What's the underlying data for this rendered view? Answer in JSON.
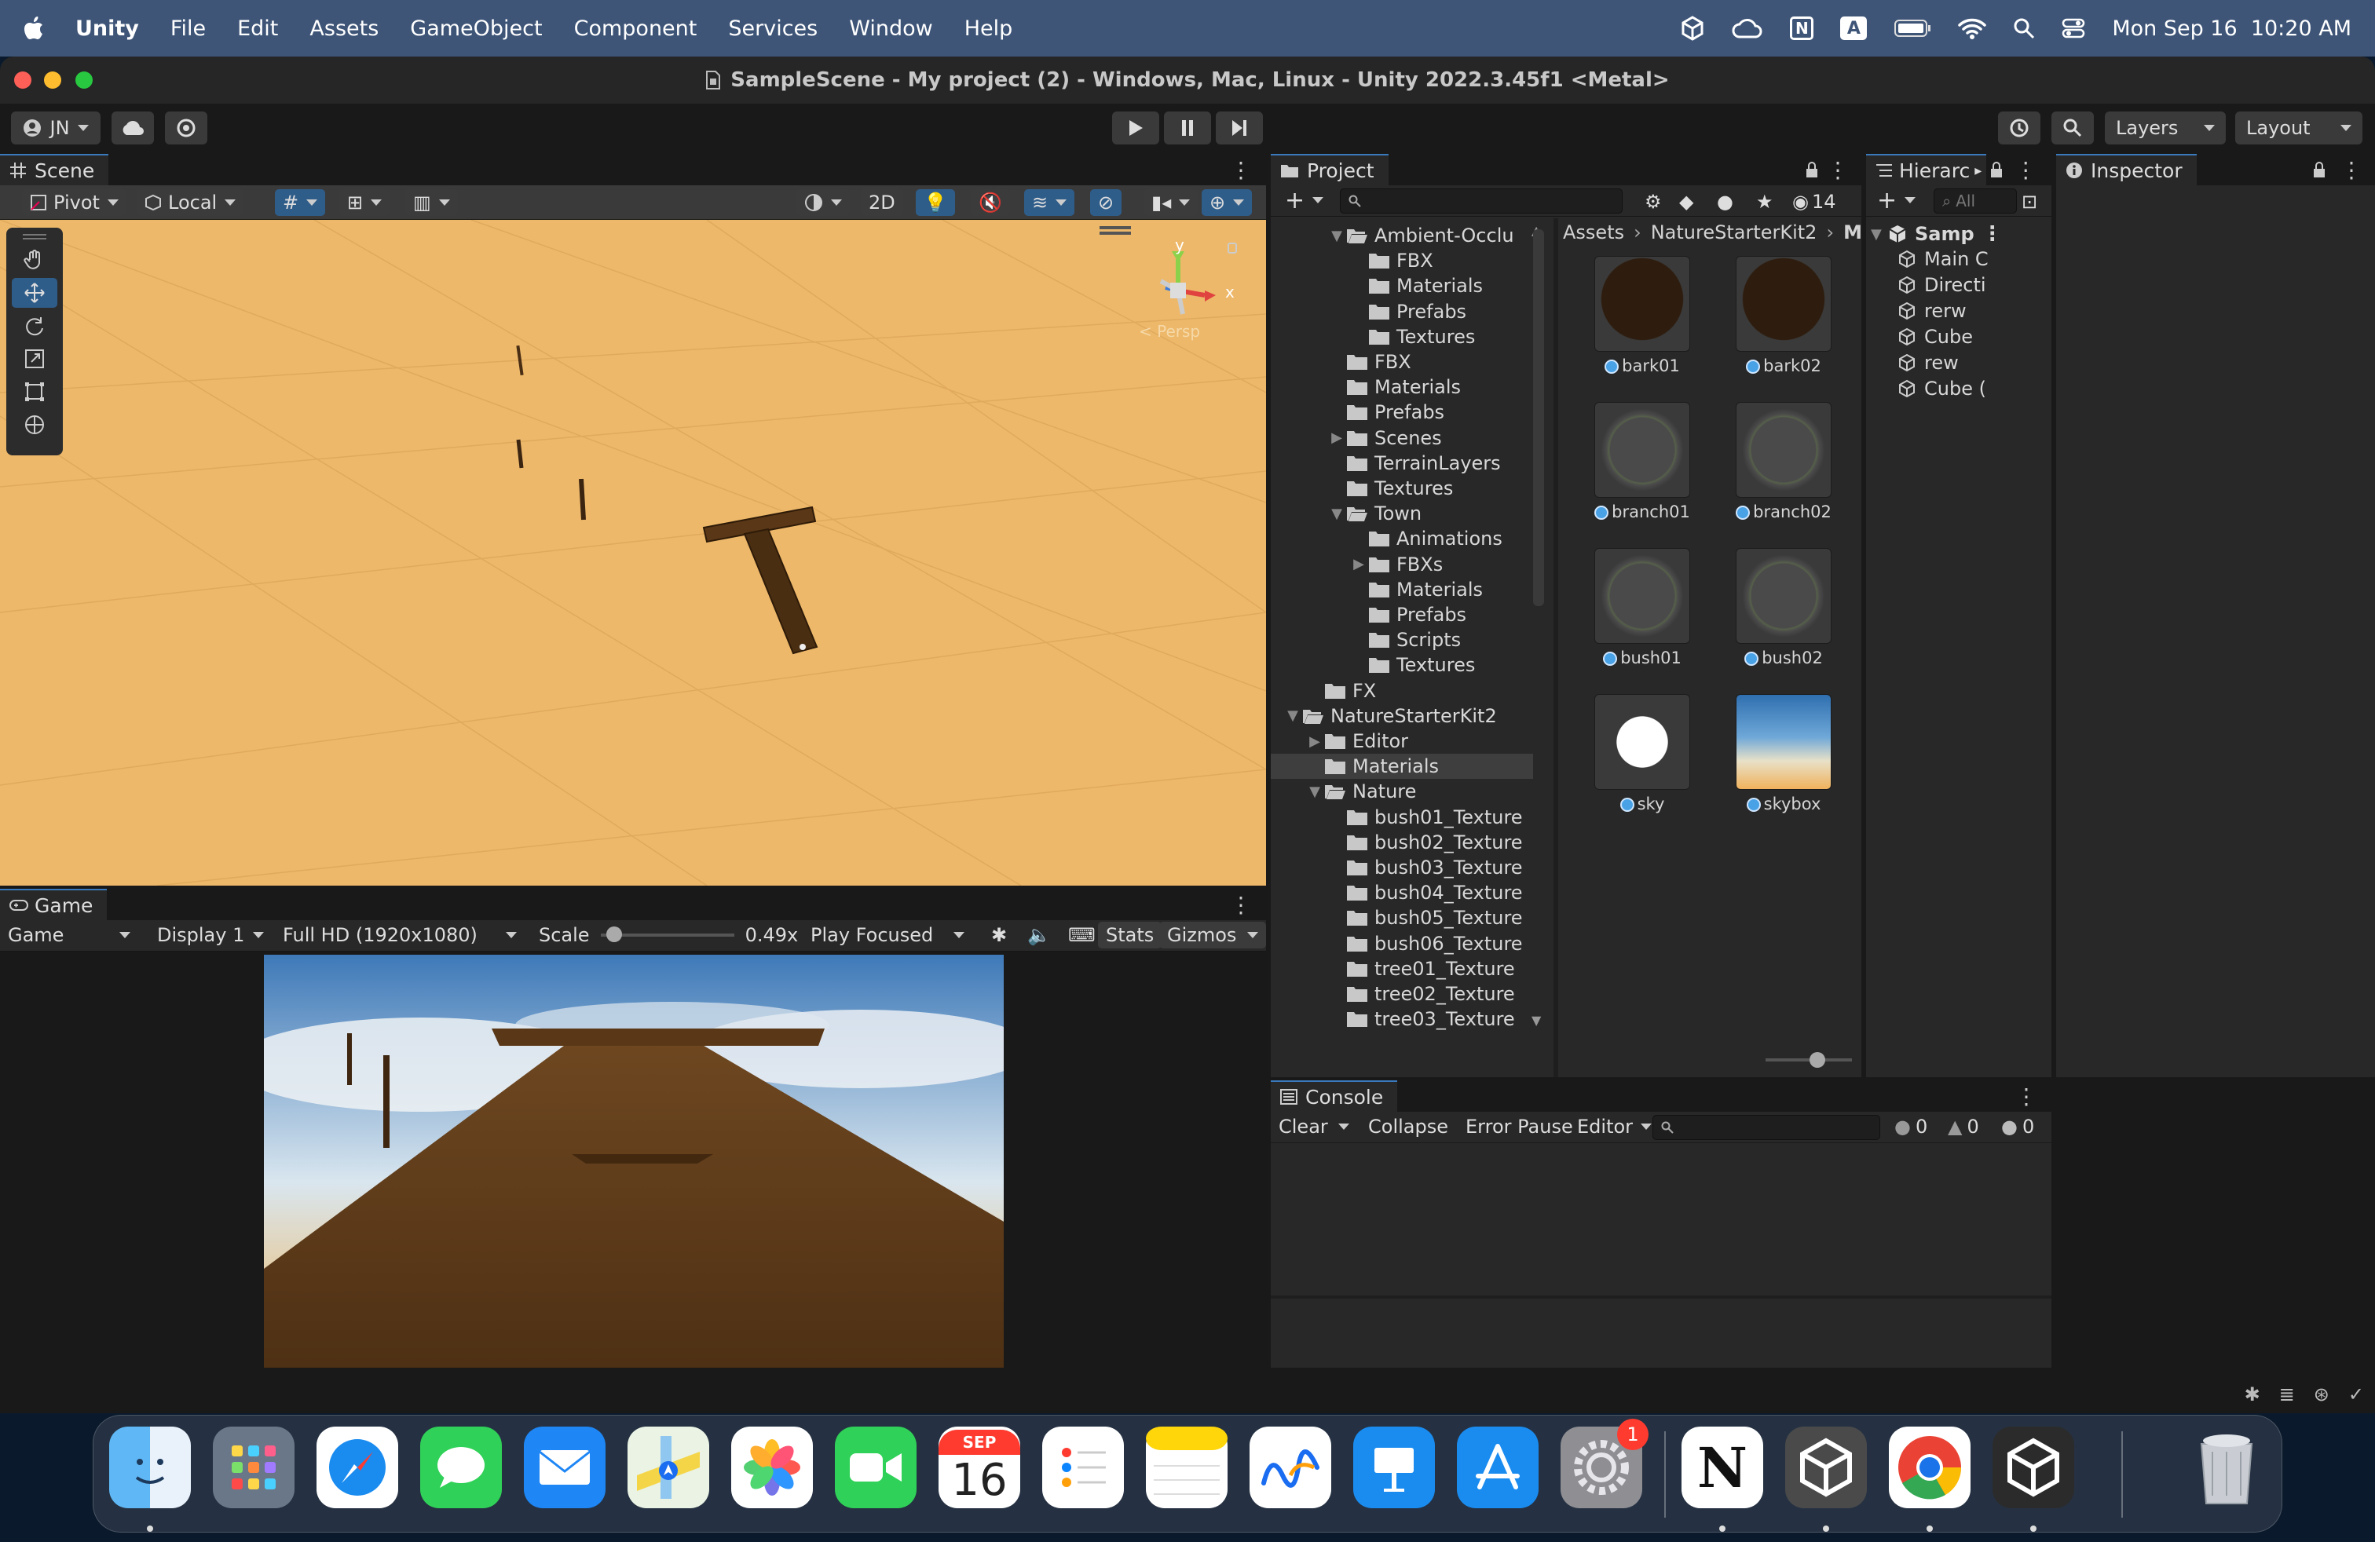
{
  "menubar": {
    "app": "Unity",
    "items": [
      "File",
      "Edit",
      "Assets",
      "GameObject",
      "Component",
      "Services",
      "Window",
      "Help"
    ],
    "status_letters": {
      "notion": "N",
      "input": "A"
    },
    "clock": "Mon Sep 16  10:20 AM"
  },
  "window": {
    "title": "SampleScene - My project (2) - Windows, Mac, Linux - Unity 2022.3.45f1 <Metal>"
  },
  "toolbar": {
    "account": "JN",
    "layers": "Layers",
    "layout": "Layout"
  },
  "scene": {
    "tab": "Scene",
    "pivot": "Pivot",
    "local": "Local",
    "mode_2d": "2D",
    "gizmo_y": "y",
    "gizmo_x": "x",
    "persp": "< Persp"
  },
  "game": {
    "tab": "Game",
    "view": "Game",
    "display": "Display 1",
    "resolution": "Full HD (1920x1080)",
    "scale_label": "Scale",
    "scale_value": "0.49x",
    "scale_level": 0.05,
    "play_mode": "Play Focused",
    "stats": "Stats",
    "gizmos": "Gizmos"
  },
  "project": {
    "tab": "Project",
    "hidden_count": "14",
    "breadcrumb": [
      "Assets",
      "NatureStarterKit2",
      "Mat"
    ],
    "tree": [
      {
        "label": "Ambient-Occlu",
        "depth": 2,
        "arrow": "open",
        "open": true
      },
      {
        "label": "FBX",
        "depth": 3
      },
      {
        "label": "Materials",
        "depth": 3
      },
      {
        "label": "Prefabs",
        "depth": 3
      },
      {
        "label": "Textures",
        "depth": 3
      },
      {
        "label": "FBX",
        "depth": 2
      },
      {
        "label": "Materials",
        "depth": 2
      },
      {
        "label": "Prefabs",
        "depth": 2
      },
      {
        "label": "Scenes",
        "depth": 2,
        "arrow": "closed"
      },
      {
        "label": "TerrainLayers",
        "depth": 2
      },
      {
        "label": "Textures",
        "depth": 2
      },
      {
        "label": "Town",
        "depth": 2,
        "arrow": "open",
        "open": true
      },
      {
        "label": "Animations",
        "depth": 3
      },
      {
        "label": "FBXs",
        "depth": 3,
        "arrow": "closed"
      },
      {
        "label": "Materials",
        "depth": 3
      },
      {
        "label": "Prefabs",
        "depth": 3
      },
      {
        "label": "Scripts",
        "depth": 3
      },
      {
        "label": "Textures",
        "depth": 3
      },
      {
        "label": "FX",
        "depth": 1
      },
      {
        "label": "NatureStarterKit2",
        "depth": 0,
        "arrow": "open",
        "open": true
      },
      {
        "label": "Editor",
        "depth": 1,
        "arrow": "closed"
      },
      {
        "label": "Materials",
        "depth": 1,
        "selected": true
      },
      {
        "label": "Nature",
        "depth": 1,
        "arrow": "open",
        "open": true
      },
      {
        "label": "bush01_Texture",
        "depth": 2
      },
      {
        "label": "bush02_Texture",
        "depth": 2
      },
      {
        "label": "bush03_Texture",
        "depth": 2
      },
      {
        "label": "bush04_Texture",
        "depth": 2
      },
      {
        "label": "bush05_Texture",
        "depth": 2
      },
      {
        "label": "bush06_Texture",
        "depth": 2
      },
      {
        "label": "tree01_Texture",
        "depth": 2
      },
      {
        "label": "tree02_Texture",
        "depth": 2
      },
      {
        "label": "tree03_Texture",
        "depth": 2
      }
    ],
    "assets": [
      {
        "label": "bark01",
        "kind": "bark"
      },
      {
        "label": "bark02",
        "kind": "bark"
      },
      {
        "label": "branch01",
        "kind": "leaf"
      },
      {
        "label": "branch02",
        "kind": "leaf"
      },
      {
        "label": "bush01",
        "kind": "leaf"
      },
      {
        "label": "bush02",
        "kind": "leaf"
      },
      {
        "label": "sky",
        "kind": "white"
      },
      {
        "label": "skybox",
        "kind": "sky"
      }
    ]
  },
  "hierarchy": {
    "tab": "Hierarc",
    "search_placeholder": "All",
    "scene": "Samp",
    "items": [
      "Main C",
      "Directi",
      "rerw",
      "Cube",
      "rew",
      "Cube ("
    ]
  },
  "inspector": {
    "tab": "Inspector"
  },
  "console": {
    "tab": "Console",
    "clear": "Clear",
    "collapse": "Collapse",
    "error_pause": "Error Pause",
    "editor": "Editor",
    "info_count": "0",
    "warn_count": "0",
    "error_count": "0"
  },
  "dock": {
    "calendar_month": "SEP",
    "calendar_day": "16",
    "settings_badge": "1",
    "notion_letter": "N"
  }
}
